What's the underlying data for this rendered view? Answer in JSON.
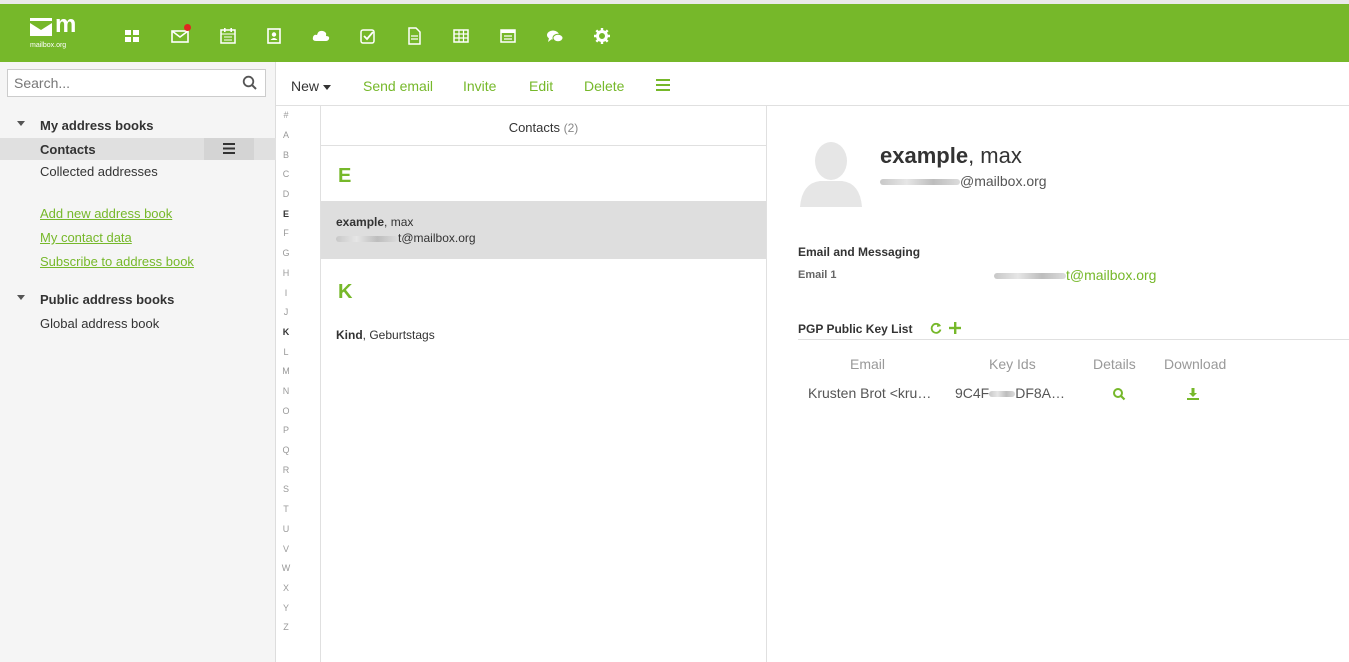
{
  "app": {
    "logo_mark": "m",
    "logo_text": "mailbox.org",
    "accent": "#76b82a",
    "top_icons": [
      "apps-grid-icon",
      "mail-icon",
      "calendar-icon",
      "address-book-icon",
      "cloud-icon",
      "tasks-icon",
      "document-icon",
      "spreadsheet-icon",
      "presentation-icon",
      "chat-icon",
      "settings-gear-icon"
    ]
  },
  "sidebar": {
    "search_placeholder": "Search...",
    "my_books_title": "My address books",
    "contacts_label": "Contacts",
    "collected_label": "Collected addresses",
    "add_book_link": "Add new address book",
    "my_contact_link": "My contact data",
    "subscribe_link": "Subscribe to address book",
    "public_books_title": "Public address books",
    "global_book_label": "Global address book"
  },
  "toolbar": {
    "new_label": "New",
    "send_email_label": "Send email",
    "invite_label": "Invite",
    "edit_label": "Edit",
    "delete_label": "Delete"
  },
  "letters": [
    "#",
    "A",
    "B",
    "C",
    "D",
    "E",
    "F",
    "G",
    "H",
    "I",
    "J",
    "K",
    "L",
    "M",
    "N",
    "O",
    "P",
    "Q",
    "R",
    "S",
    "T",
    "U",
    "V",
    "W",
    "X",
    "Y",
    "Z"
  ],
  "list": {
    "title": "Contacts",
    "count": "(2)",
    "section_e": "E",
    "contact1_last": "example",
    "contact1_first": ", max",
    "contact1_email_suffix": "t@mailbox.org",
    "section_k": "K",
    "contact2_last": "Kind",
    "contact2_first": ", Geburtstags"
  },
  "detail": {
    "last_name": "example",
    "first_name": ", max",
    "email_suffix": "@mailbox.org",
    "section_title": "Email and Messaging",
    "email1_label": "Email 1",
    "email1_suffix": "t@mailbox.org",
    "pgp_title": "PGP Public Key List",
    "col_email": "Email",
    "col_keyids": "Key Ids",
    "col_details": "Details",
    "col_download": "Download",
    "row_email": "Krusten Brot <kru…",
    "row_key_prefix": "9C4F",
    "row_key_suffix": "DF8A…"
  }
}
